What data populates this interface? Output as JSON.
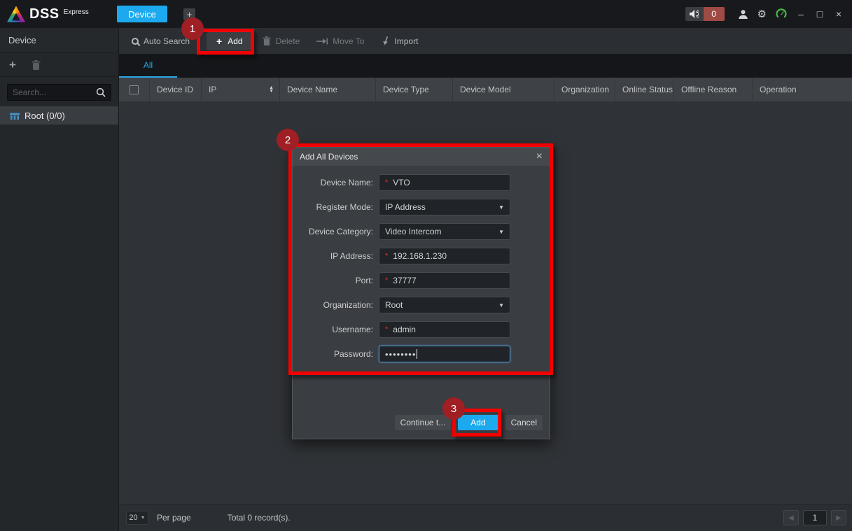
{
  "topbar": {
    "brand": "DSS",
    "brand_suffix": "Express",
    "device_tab": "Device",
    "new_tab": "+",
    "alarm_count": "0",
    "gear_glyph": "⚙",
    "window": {
      "minimize": "–",
      "maximize": "□",
      "close": "×"
    }
  },
  "sidebar": {
    "title": "Device",
    "add_glyph": "+",
    "search_placeholder": "Search...",
    "root_item": "Root (0/0)"
  },
  "toolbar": {
    "auto_search": "Auto Search",
    "add_glyph": "+",
    "add": "Add",
    "delete": "Delete",
    "move_to": "Move To",
    "import": "Import"
  },
  "tabbar": {
    "all": "All"
  },
  "table": {
    "columns": [
      "Device ID",
      "IP",
      "Device Name",
      "Device Type",
      "Device Model",
      "Organization",
      "Online Status",
      "Offline Reason",
      "Operation"
    ],
    "sort_asc": "▲",
    "sort_desc": "▼"
  },
  "dialog": {
    "title": "Add All Devices",
    "close_glyph": "×",
    "caret_glyph": "▼",
    "fields": [
      {
        "label": "Device Name:",
        "req": "*",
        "value": "VTO"
      },
      {
        "label": "Register Mode:",
        "value": "IP Address"
      },
      {
        "label": "Device Category:",
        "value": "Video Intercom"
      },
      {
        "label": "IP Address:",
        "req": "*",
        "value": "192.168.1.230"
      },
      {
        "label": "Port:",
        "req": "*",
        "value": "37777"
      },
      {
        "label": "Organization:",
        "value": "Root"
      },
      {
        "label": "Username:",
        "req": "*",
        "value": "admin"
      },
      {
        "label": "Password:",
        "value": "••••••••"
      }
    ],
    "buttons": {
      "continue": "Continue t...",
      "add": "Add",
      "cancel": "Cancel"
    }
  },
  "footer": {
    "page_size": "20",
    "caret_glyph": "▼",
    "per_page": "Per page",
    "total": "Total 0 record(s).",
    "prev_glyph": "◀",
    "page": "1",
    "next_glyph": "▶"
  },
  "annotations": {
    "step1": "1",
    "step2": "2",
    "step3": "3"
  },
  "colors": {
    "accent": "#1ca9ee",
    "annotation_red": "#f20000",
    "annotation_circle": "#9f1f24",
    "alarm_badge": "#a04a46"
  }
}
